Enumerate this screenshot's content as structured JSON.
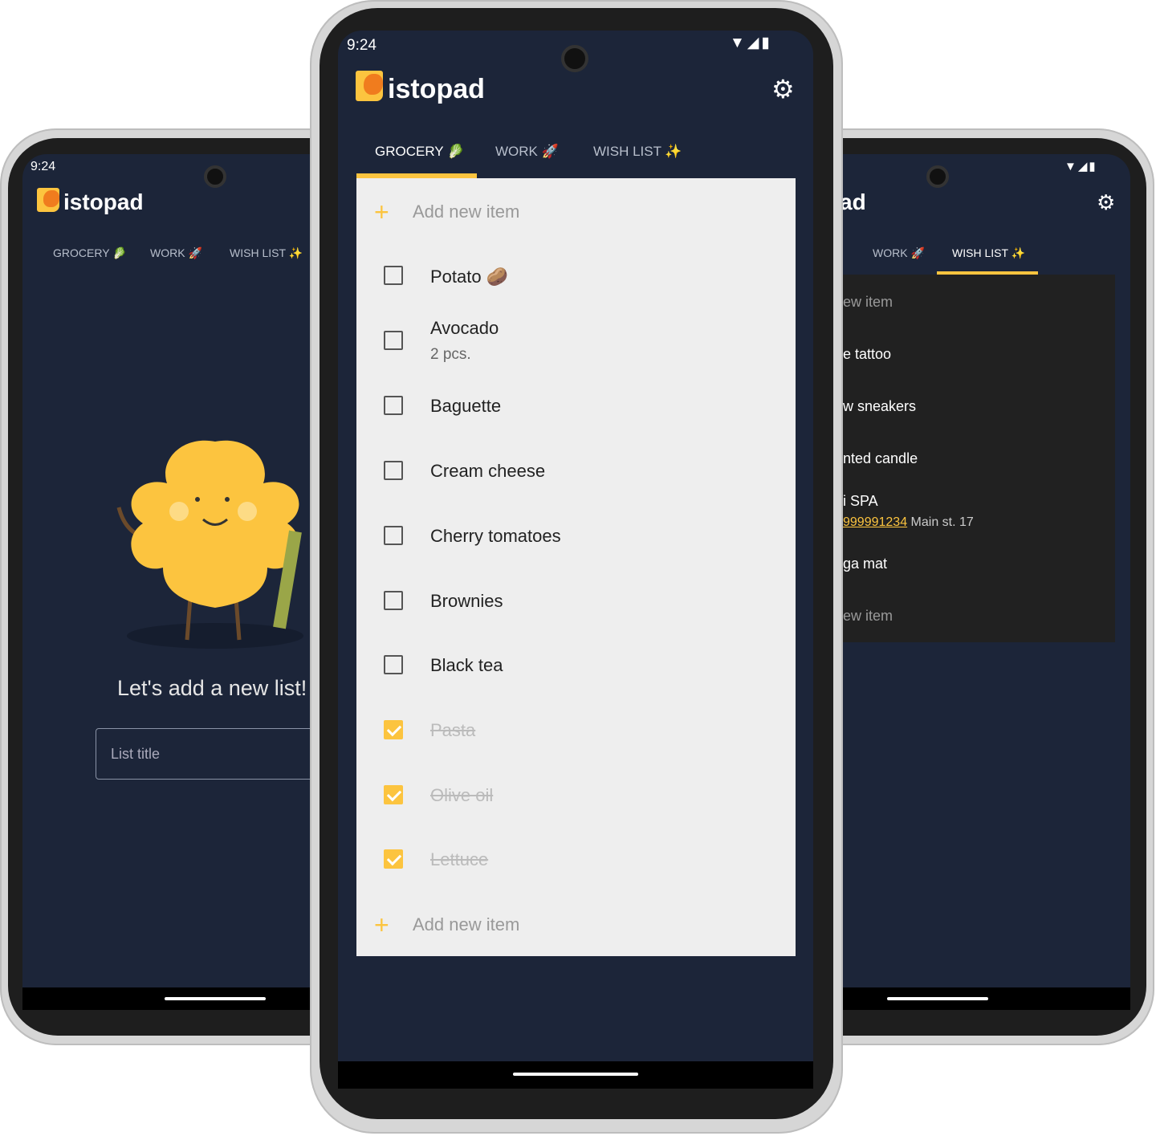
{
  "colors": {
    "background": "#1c2539",
    "accent": "#fcc43f",
    "list_bg": "#eeeeee",
    "dark_list_bg": "#212121"
  },
  "left_phone": {
    "time": "9:24",
    "app_name": "istopad",
    "tabs": [
      {
        "label": "GROCERY 🥬"
      },
      {
        "label": "WORK 🚀"
      },
      {
        "label": "WISH LIST ✨"
      }
    ],
    "empty_message": "Let's add a new list!",
    "list_title_placeholder": "List title"
  },
  "center_phone": {
    "time": "9:24",
    "app_name": "istopad",
    "settings_icon": "gear-icon",
    "tabs": [
      {
        "label": "GROCERY 🥬",
        "active": true
      },
      {
        "label": "WORK 🚀"
      },
      {
        "label": "WISH LIST ✨"
      }
    ],
    "add_item_label": "Add new item",
    "items": [
      {
        "title": "Potato 🥔",
        "checked": false
      },
      {
        "title": "Avocado",
        "note": "2 pcs.",
        "checked": false
      },
      {
        "title": "Baguette",
        "checked": false
      },
      {
        "title": "Cream cheese",
        "checked": false
      },
      {
        "title": "Cherry tomatoes",
        "checked": false
      },
      {
        "title": "Brownies",
        "checked": false
      },
      {
        "title": "Black tea",
        "checked": false
      },
      {
        "title": "Pasta",
        "checked": true
      },
      {
        "title": "Olive oil",
        "checked": true
      },
      {
        "title": "Lettuce",
        "checked": true
      }
    ],
    "add_item_bottom_label": "Add new item"
  },
  "right_phone": {
    "app_name_fragment": "ad",
    "tabs": [
      {
        "label": "WORK 🚀"
      },
      {
        "label": "WISH LIST ✨",
        "active": true
      }
    ],
    "items": [
      {
        "text": "ew item",
        "placeholder": true
      },
      {
        "text": "e tattoo"
      },
      {
        "text": "w sneakers"
      },
      {
        "text": "nted candle"
      },
      {
        "text": "i SPA",
        "link": "999991234",
        "note": "Main st. 17"
      },
      {
        "text": "ga mat"
      },
      {
        "text": "ew item",
        "placeholder": true
      }
    ]
  }
}
